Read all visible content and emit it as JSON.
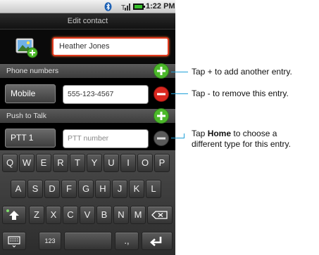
{
  "status_bar": {
    "time": "1:22 PM",
    "icons": [
      "bluetooth-icon",
      "signal-icon",
      "battery-icon"
    ]
  },
  "title": "Edit contact",
  "contact": {
    "name": "Heather Jones",
    "photo_icon": "add-photo-icon"
  },
  "phone_section": {
    "header": "Phone numbers",
    "type": "Mobile",
    "number": "555-123-4567"
  },
  "ptt_section": {
    "header": "Push to Talk",
    "type": "PTT 1",
    "placeholder": "PTT number"
  },
  "keyboard": {
    "row1": [
      "Q",
      "W",
      "E",
      "R",
      "T",
      "Y",
      "U",
      "I",
      "O",
      "P"
    ],
    "row2": [
      "A",
      "S",
      "D",
      "F",
      "G",
      "H",
      "J",
      "K",
      "L"
    ],
    "row3": [
      "Z",
      "X",
      "C",
      "V",
      "B",
      "N",
      "M"
    ],
    "numbers_label": "123",
    "punct_label": ".,",
    "icons": [
      "shift-icon",
      "backspace-icon",
      "keyboard-settings-icon",
      "enter-icon"
    ]
  },
  "callouts": {
    "add": "Tap + to add another entry.",
    "remove": "Tap - to remove this entry.",
    "home_prefix": "Tap ",
    "home_bold": "Home",
    "home_suffix": " to choose a",
    "home_line2": "different type for this entry."
  },
  "colors": {
    "accent_green": "#4cb82a",
    "accent_red": "#d9271f",
    "leader_blue": "#1fa0d8",
    "focus_orange": "#e23a1e"
  }
}
